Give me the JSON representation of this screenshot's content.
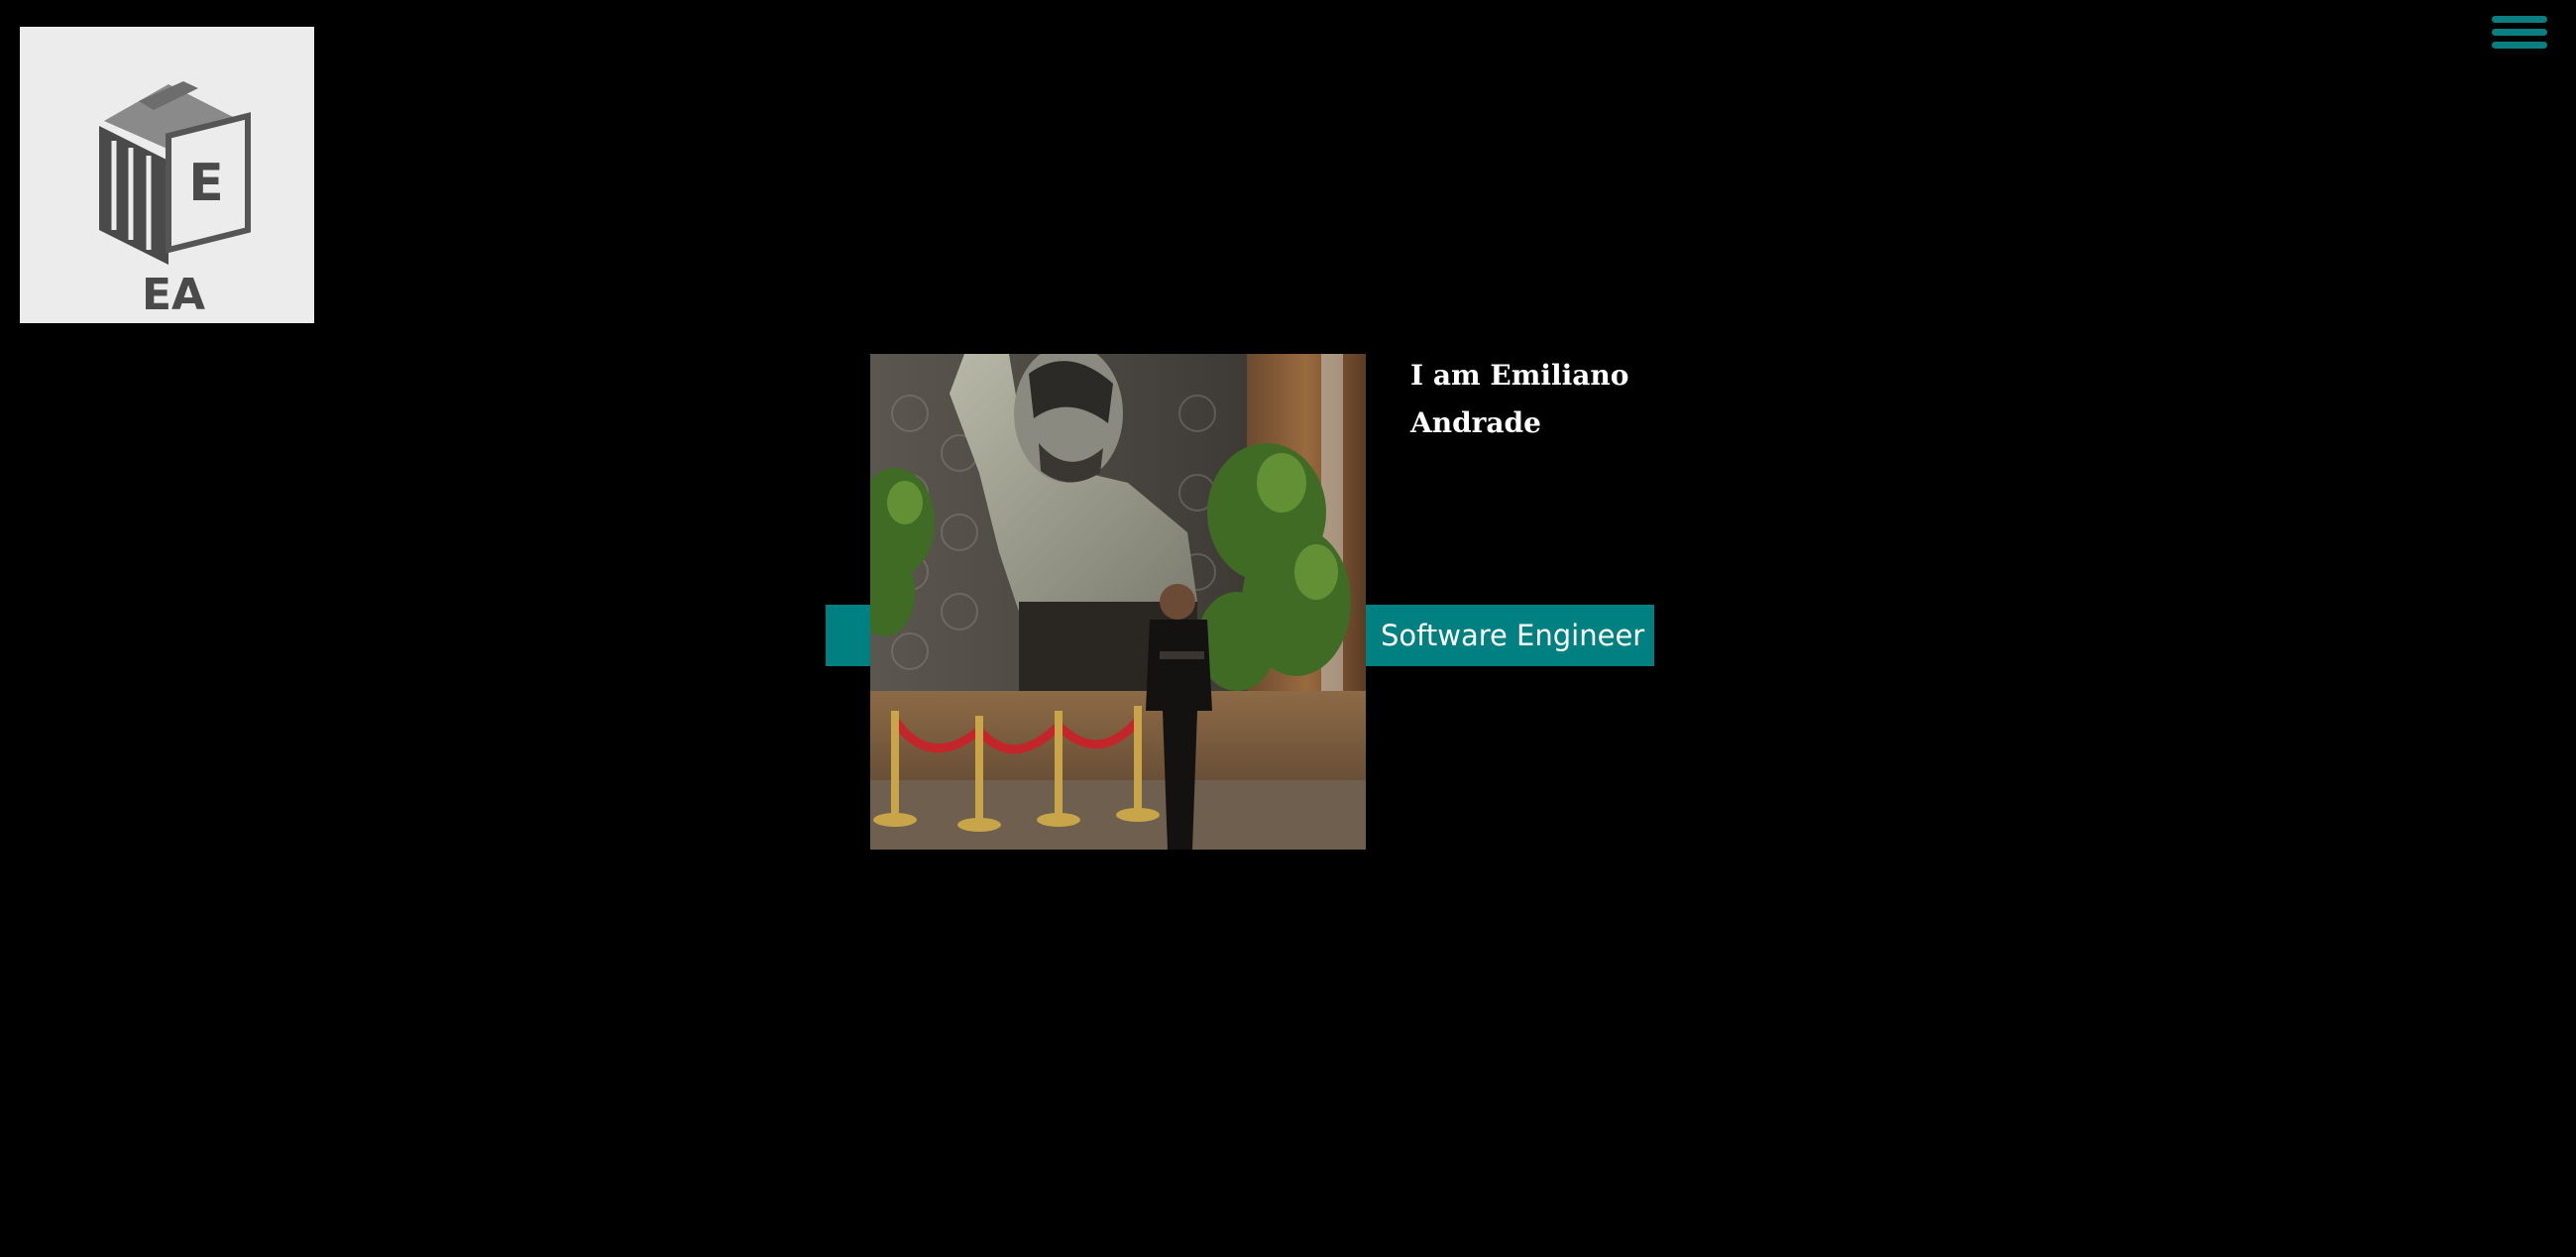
{
  "logo": {
    "letter": "E",
    "initials": "EA"
  },
  "menu": {
    "icon": "hamburger-menu-icon"
  },
  "hero": {
    "name_line1": "I am Emiliano",
    "name_line2": "Andrade",
    "role": "Software Engineer",
    "photo": "profile-photo"
  },
  "colors": {
    "background": "#000000",
    "accent": "#008080",
    "logo_bg": "#ececec",
    "text": "#ffffff"
  }
}
